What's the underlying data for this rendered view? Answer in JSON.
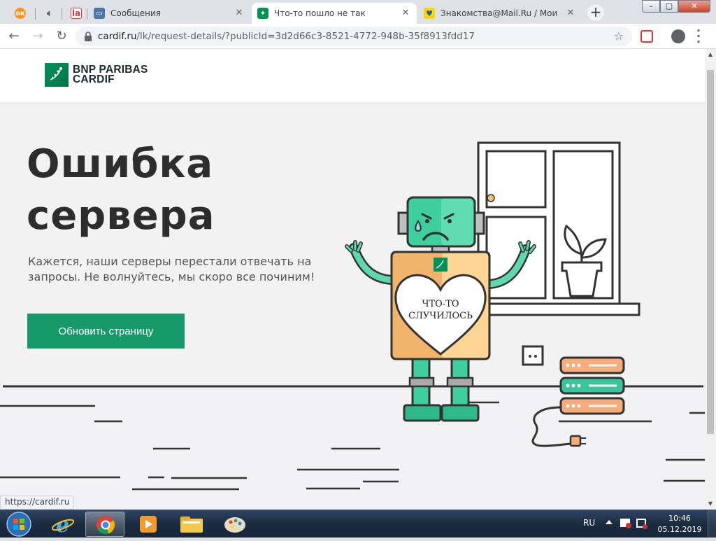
{
  "browser": {
    "tabs": [
      {
        "title": "",
        "icon": "odnoklassniki-icon"
      },
      {
        "title": "",
        "icon": "audio-icon"
      },
      {
        "title": "",
        "icon": "la-icon"
      },
      {
        "title": "Сообщения",
        "icon": "messages-icon"
      },
      {
        "title": "Что-то пошло не так",
        "icon": "bnp-paribas-icon",
        "active": true
      },
      {
        "title": "Знакомства@Mail.Ru / Мои сос",
        "icon": "heart-icon"
      }
    ],
    "new_tab": "+",
    "window_controls": {
      "minimize": "–",
      "maximize": "▢",
      "close": "✕"
    },
    "url_host": "cardif.ru",
    "url_path": "/lk/request-details/?publicId=3d2d66c3-8521-4772-948b-35f8913fdd17",
    "status_url": "https://cardif.ru"
  },
  "site": {
    "logo_line1": "BNP PARIBAS",
    "logo_line2": "CARDIF",
    "title_line1": "Ошибка",
    "title_line2": "сервера",
    "subtitle": "Кажется, наши серверы перестали отвечать на запросы. Не волнуйтесь, мы скоро все починим!",
    "refresh_button": "Обновить страницу",
    "heart_line1": "ЧТО-ТО",
    "heart_line2": "СЛУЧИЛОСЬ",
    "brand_green": "#17996c"
  },
  "taskbar": {
    "language": "RU",
    "time": "10:46",
    "date": "05.12.2019",
    "apps": [
      "internet-explorer",
      "chrome",
      "media-player",
      "file-explorer",
      "paint"
    ]
  }
}
